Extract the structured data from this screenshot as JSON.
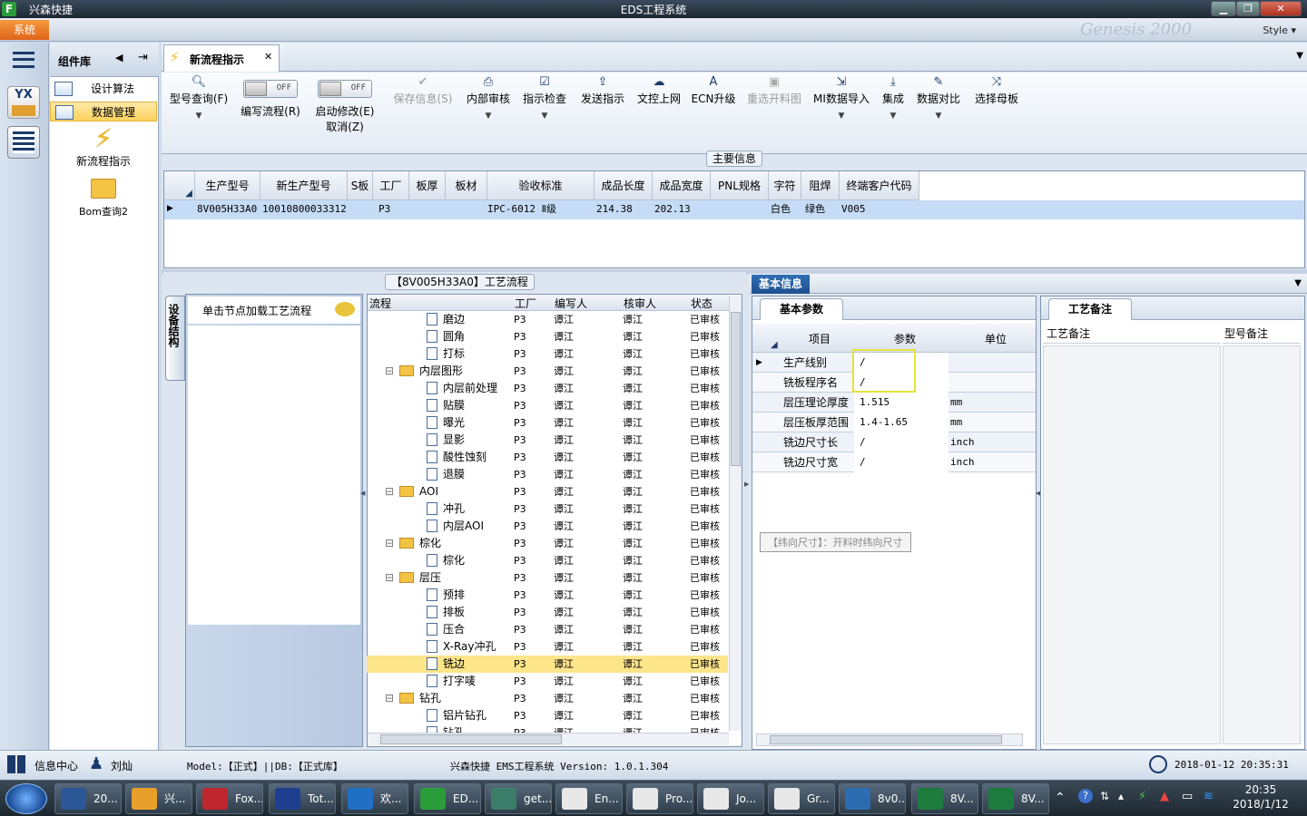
{
  "titlebar": {
    "app_name": "兴森快捷",
    "window_title": "EDS工程系统"
  },
  "menubar": {
    "system": "系统",
    "style": "Style",
    "watermark": "Genesis 2000"
  },
  "complib": {
    "title": "组件库",
    "items": [
      {
        "label": "设计算法",
        "icon": "table-icon"
      },
      {
        "label": "数据管理",
        "icon": "table-icon"
      }
    ],
    "actions": [
      {
        "label": "新流程指示",
        "icon": "lightning-icon"
      },
      {
        "label": "Bom查询2",
        "icon": "folder-icon"
      }
    ]
  },
  "doc_tab": {
    "label": "新流程指示"
  },
  "ribbon": {
    "query": "型号查询(F)",
    "edit_flow": "编写流程(R)",
    "edit_flow_toggle": "OFF",
    "start_modify": "启动修改(E)",
    "start_modify_toggle": "OFF",
    "cancel": "取消(Z)",
    "save": "保存信息(S)",
    "review": "内部审核",
    "check": "指示检查",
    "send": "发送指示",
    "upload": "文控上网",
    "ecn": "ECN升级",
    "reselect": "重选开料图",
    "mi_import": "MI数据导入",
    "integrate": "集成",
    "compare": "数据对比",
    "select_board": "选择母板"
  },
  "main_info": {
    "title": "主要信息",
    "columns": [
      "生产型号",
      "新生产型号",
      "S板",
      "工厂",
      "板厚",
      "板材",
      "验收标准",
      "成品长度",
      "成品宽度",
      "PNL规格",
      "字符",
      "阻焊",
      "终端客户代码"
    ],
    "row": [
      "8V005H33A0",
      "10010800033312",
      "",
      "P3",
      "",
      "",
      "IPC-6012 Ⅱ级",
      "214.38",
      "202.13",
      "",
      "白色",
      "绿色",
      "V005"
    ]
  },
  "flow": {
    "title": "【8V005H33A0】工艺流程",
    "side_tab": "设备结构",
    "load_text": "单击节点加载工艺流程",
    "columns": [
      "流程",
      "工厂",
      "编写人",
      "核审人",
      "状态"
    ],
    "rows": [
      {
        "name": "磨边",
        "level": 2,
        "type": "doc",
        "factory": "P3",
        "writer": "谭江",
        "reviewer": "谭江",
        "status": "已审核"
      },
      {
        "name": "圆角",
        "level": 2,
        "type": "doc",
        "factory": "P3",
        "writer": "谭江",
        "reviewer": "谭江",
        "status": "已审核"
      },
      {
        "name": "打标",
        "level": 2,
        "type": "doc",
        "factory": "P3",
        "writer": "谭江",
        "reviewer": "谭江",
        "status": "已审核"
      },
      {
        "name": "内层图形",
        "level": 1,
        "type": "folder",
        "factory": "P3",
        "writer": "谭江",
        "reviewer": "谭江",
        "status": "已审核"
      },
      {
        "name": "内层前处理",
        "level": 2,
        "type": "doc",
        "factory": "P3",
        "writer": "谭江",
        "reviewer": "谭江",
        "status": "已审核"
      },
      {
        "name": "贴膜",
        "level": 2,
        "type": "doc",
        "factory": "P3",
        "writer": "谭江",
        "reviewer": "谭江",
        "status": "已审核"
      },
      {
        "name": "曝光",
        "level": 2,
        "type": "doc",
        "factory": "P3",
        "writer": "谭江",
        "reviewer": "谭江",
        "status": "已审核"
      },
      {
        "name": "显影",
        "level": 2,
        "type": "doc",
        "factory": "P3",
        "writer": "谭江",
        "reviewer": "谭江",
        "status": "已审核"
      },
      {
        "name": "酸性蚀刻",
        "level": 2,
        "type": "doc",
        "factory": "P3",
        "writer": "谭江",
        "reviewer": "谭江",
        "status": "已审核"
      },
      {
        "name": "退膜",
        "level": 2,
        "type": "doc",
        "factory": "P3",
        "writer": "谭江",
        "reviewer": "谭江",
        "status": "已审核"
      },
      {
        "name": "AOI",
        "level": 1,
        "type": "folder",
        "factory": "P3",
        "writer": "谭江",
        "reviewer": "谭江",
        "status": "已审核"
      },
      {
        "name": "冲孔",
        "level": 2,
        "type": "doc",
        "factory": "P3",
        "writer": "谭江",
        "reviewer": "谭江",
        "status": "已审核"
      },
      {
        "name": "内层AOI",
        "level": 2,
        "type": "doc",
        "factory": "P3",
        "writer": "谭江",
        "reviewer": "谭江",
        "status": "已审核"
      },
      {
        "name": "棕化",
        "level": 1,
        "type": "folder",
        "factory": "P3",
        "writer": "谭江",
        "reviewer": "谭江",
        "status": "已审核"
      },
      {
        "name": "棕化",
        "level": 2,
        "type": "doc",
        "factory": "P3",
        "writer": "谭江",
        "reviewer": "谭江",
        "status": "已审核"
      },
      {
        "name": "层压",
        "level": 1,
        "type": "folder",
        "factory": "P3",
        "writer": "谭江",
        "reviewer": "谭江",
        "status": "已审核"
      },
      {
        "name": "预排",
        "level": 2,
        "type": "doc",
        "factory": "P3",
        "writer": "谭江",
        "reviewer": "谭江",
        "status": "已审核"
      },
      {
        "name": "排板",
        "level": 2,
        "type": "doc",
        "factory": "P3",
        "writer": "谭江",
        "reviewer": "谭江",
        "status": "已审核"
      },
      {
        "name": "压合",
        "level": 2,
        "type": "doc",
        "factory": "P3",
        "writer": "谭江",
        "reviewer": "谭江",
        "status": "已审核"
      },
      {
        "name": "X-Ray冲孔",
        "level": 2,
        "type": "doc",
        "factory": "P3",
        "writer": "谭江",
        "reviewer": "谭江",
        "status": "已审核"
      },
      {
        "name": "铣边",
        "level": 2,
        "type": "doc",
        "factory": "P3",
        "writer": "谭江",
        "reviewer": "谭江",
        "status": "已审核",
        "selected": true
      },
      {
        "name": "打字唛",
        "level": 2,
        "type": "doc",
        "factory": "P3",
        "writer": "谭江",
        "reviewer": "谭江",
        "status": "已审核"
      },
      {
        "name": "钻孔",
        "level": 1,
        "type": "folder",
        "factory": "P3",
        "writer": "谭江",
        "reviewer": "谭江",
        "status": "已审核"
      },
      {
        "name": "铝片钻孔",
        "level": 2,
        "type": "doc",
        "factory": "P3",
        "writer": "谭江",
        "reviewer": "谭江",
        "status": "已审核"
      },
      {
        "name": "钻孔",
        "level": 2,
        "type": "doc",
        "factory": "P3",
        "writer": "谭江",
        "reviewer": "谭江",
        "status": "已审核"
      }
    ]
  },
  "basic": {
    "header": "基本信息",
    "tab": "基本参数",
    "columns": [
      "项目",
      "参数",
      "单位"
    ],
    "rows": [
      {
        "item": "生产线别",
        "param": "/",
        "unit": ""
      },
      {
        "item": "铣板程序名",
        "param": "/",
        "unit": ""
      },
      {
        "item": "层压理论厚度",
        "param": "1.515",
        "unit": "mm"
      },
      {
        "item": "层压板厚范围",
        "param": "1.4-1.65",
        "unit": "mm"
      },
      {
        "item": "铣边尺寸长",
        "param": "/",
        "unit": "inch"
      },
      {
        "item": "铣边尺寸宽",
        "param": "/",
        "unit": "inch"
      }
    ],
    "tooltip": "【纬向尺寸】：开料时纬向尺寸"
  },
  "remark": {
    "tab": "工艺备注",
    "col1": "工艺备注",
    "col2": "型号备注"
  },
  "status": {
    "info_center": "信息中心",
    "user": "刘灿",
    "model": "Model:【正式】||DB:【正式库】",
    "system": "兴森快捷 EMS工程系统 Version: 1.0.1.304",
    "datetime": "2018-01-12 20:35:31"
  },
  "taskbar": {
    "items": [
      {
        "label": "20...",
        "color": "#2b5797"
      },
      {
        "label": "兴...",
        "color": "#e8a02a"
      },
      {
        "label": "Fox...",
        "color": "#c0262d"
      },
      {
        "label": "Tot...",
        "color": "#1e3f8f"
      },
      {
        "label": "欢...",
        "color": "#1f6fc4"
      },
      {
        "label": "ED...",
        "color": "#2a9d3a"
      },
      {
        "label": "get...",
        "color": "#3c7d6a"
      },
      {
        "label": "En...",
        "color": "#e8e8e8"
      },
      {
        "label": "Pro...",
        "color": "#e8e8e8"
      },
      {
        "label": "Jo...",
        "color": "#e8e8e8"
      },
      {
        "label": "Gr...",
        "color": "#e8e8e8"
      },
      {
        "label": "8v0...",
        "color": "#2b6cb0"
      },
      {
        "label": "8V...",
        "color": "#1e7b3e"
      },
      {
        "label": "8V...",
        "color": "#1e7b3e"
      }
    ],
    "time": "20:35",
    "date": "2018/1/12"
  }
}
